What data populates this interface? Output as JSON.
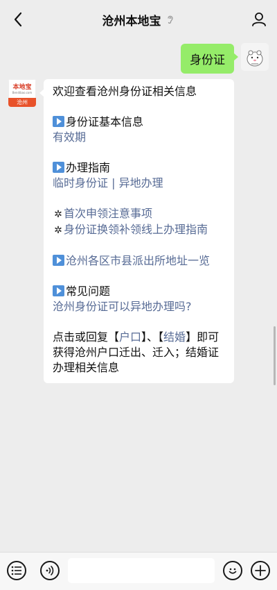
{
  "header": {
    "title": "沧州本地宝"
  },
  "user_message": {
    "text": "身份证"
  },
  "bot_avatar": {
    "logo_text": "本地宝",
    "logo_sub": "Bendibao.com",
    "city": "沧州"
  },
  "bot_message": {
    "intro": "欢迎查看沧州身份证相关信息",
    "basic_info": {
      "heading": "身份证基本信息",
      "links": [
        "有效期"
      ]
    },
    "guide": {
      "heading": "办理指南",
      "link_1": "临时身份证",
      "separator": "|",
      "link_2": "异地办理"
    },
    "notes": [
      "首次申领注意事项",
      "身份证换领补领线上办理指南"
    ],
    "police_link": "沧州各区市县派出所地址一览",
    "faq": {
      "heading": "常见问题",
      "link": "沧州身份证可以异地办理吗?"
    },
    "footer": {
      "part1": "点击或回复【",
      "kw1": "户口",
      "part2": "】、【",
      "kw2": "结婚",
      "part3": "】即可获得沧州户口迁出、迁入；结婚证办理相关信息"
    }
  },
  "input": {
    "placeholder": ""
  }
}
